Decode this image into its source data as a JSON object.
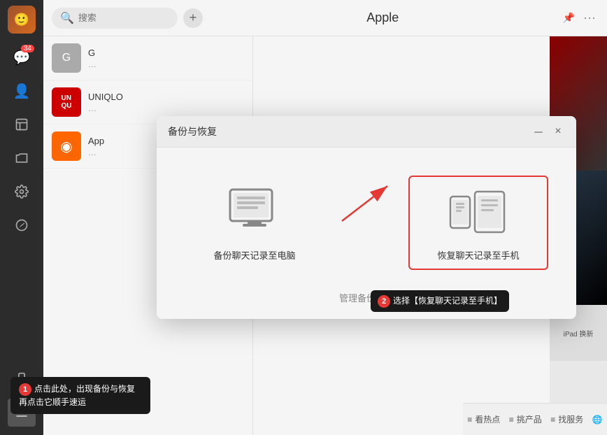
{
  "sidebar": {
    "icons": [
      {
        "name": "message",
        "symbol": "💬",
        "badge": "34",
        "active": false
      },
      {
        "name": "contacts",
        "symbol": "👤",
        "badge": "",
        "active": false
      },
      {
        "name": "3d-box",
        "symbol": "📦",
        "badge": "",
        "active": false
      },
      {
        "name": "folder",
        "symbol": "📁",
        "badge": "",
        "active": false
      },
      {
        "name": "settings",
        "symbol": "⚙️",
        "badge": "",
        "active": false
      },
      {
        "name": "discover",
        "symbol": "🔍",
        "badge": "",
        "active": false
      },
      {
        "name": "phone",
        "symbol": "📱",
        "badge": "",
        "active": false
      },
      {
        "name": "menu",
        "symbol": "☰",
        "badge": "",
        "active": true
      }
    ]
  },
  "topbar": {
    "search_placeholder": "搜索",
    "title": "Apple",
    "add_label": "+",
    "more_label": "···",
    "pin_label": "📌"
  },
  "chat_items": [
    {
      "name": "G",
      "preview": "...",
      "color": "#e53935"
    },
    {
      "name": "UN QU",
      "preview": "...",
      "color": "#333"
    },
    {
      "name": "◉",
      "preview": "...",
      "color": "#ff7700"
    }
  ],
  "modal": {
    "title": "备份与恢复",
    "minimize_label": "－",
    "close_label": "×",
    "backup_label": "备份聊天记录至电脑",
    "restore_label": "恢复聊天记录至手机",
    "manage_label": "管理备份文件"
  },
  "tooltip1": {
    "badge": "1",
    "text": "点击此处，出现备份与恢复再点击它顺手速运"
  },
  "tooltip2": {
    "badge": "2",
    "text": "选择【恢复聊天记录至手机】"
  },
  "bottom_nav": {
    "items": [
      "看热点",
      "挑产品",
      "找服务",
      "🌐"
    ]
  }
}
